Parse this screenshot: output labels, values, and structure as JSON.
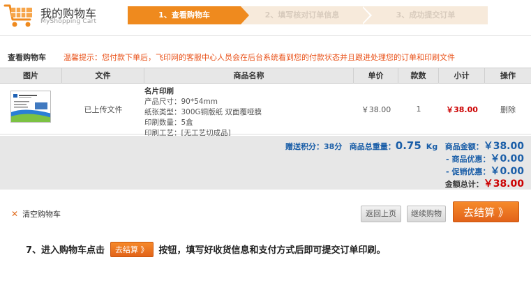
{
  "header": {
    "title": "我的购物车",
    "subtitle": "MyShopping Cart",
    "steps": [
      {
        "label": "1、查看购物车",
        "active": true
      },
      {
        "label": "2、填写核对订单信息",
        "active": false
      },
      {
        "label": "3、成功提交订单",
        "active": false
      }
    ]
  },
  "tip": {
    "label": "查看购物车",
    "text": "温馨提示：您付款下单后，飞印网的客服中心人员会在后台系统看到您的付款状态并且跟进处理您的订单和印刷文件"
  },
  "table": {
    "columns": [
      "图片",
      "文件",
      "商品名称",
      "单价",
      "款数",
      "小计",
      "操作"
    ],
    "rows": [
      {
        "file": "已上传文件",
        "name": "名片印刷",
        "size": "产品尺寸：90*54mm",
        "paper": "纸张类型：300G铜版纸 双面覆哑膜",
        "qty_spec": "印刷数量：5盒",
        "craft": "印刷工艺：[无工艺切成品]",
        "price": "￥38.00",
        "count": "1",
        "subtotal": "￥38.00",
        "action": "删除"
      }
    ]
  },
  "summary": {
    "points_label": "赠送积分：",
    "points_value": "38分",
    "weight_label": "商品总重量：",
    "weight_value": "0.75",
    "weight_unit": "Kg",
    "amount_label": "商品金额：",
    "amount_value": "￥38.00",
    "discount_label": "- 商品优惠：",
    "discount_value": "￥0.00",
    "promo_label": "- 促销优惠：",
    "promo_value": "￥0.00",
    "total_label": "金额总计：",
    "total_value": "￥38.00"
  },
  "controls": {
    "clear_label": "清空购物车",
    "back_label": "返回上页",
    "continue_label": "继续购物",
    "checkout_label": "去结算 》"
  },
  "instruction": {
    "before": "7、进入购物车点击",
    "button_label": "去结算 》",
    "after": "按钮，填写好收货信息和支付方式后即可提交订单印刷。"
  },
  "colors": {
    "accent": "#ef8a1e",
    "step_inactive_bg": "#f7eadb",
    "tip_text": "#e9521a",
    "price_red": "#cc0000",
    "summary_blue": "#1a5ea8"
  }
}
